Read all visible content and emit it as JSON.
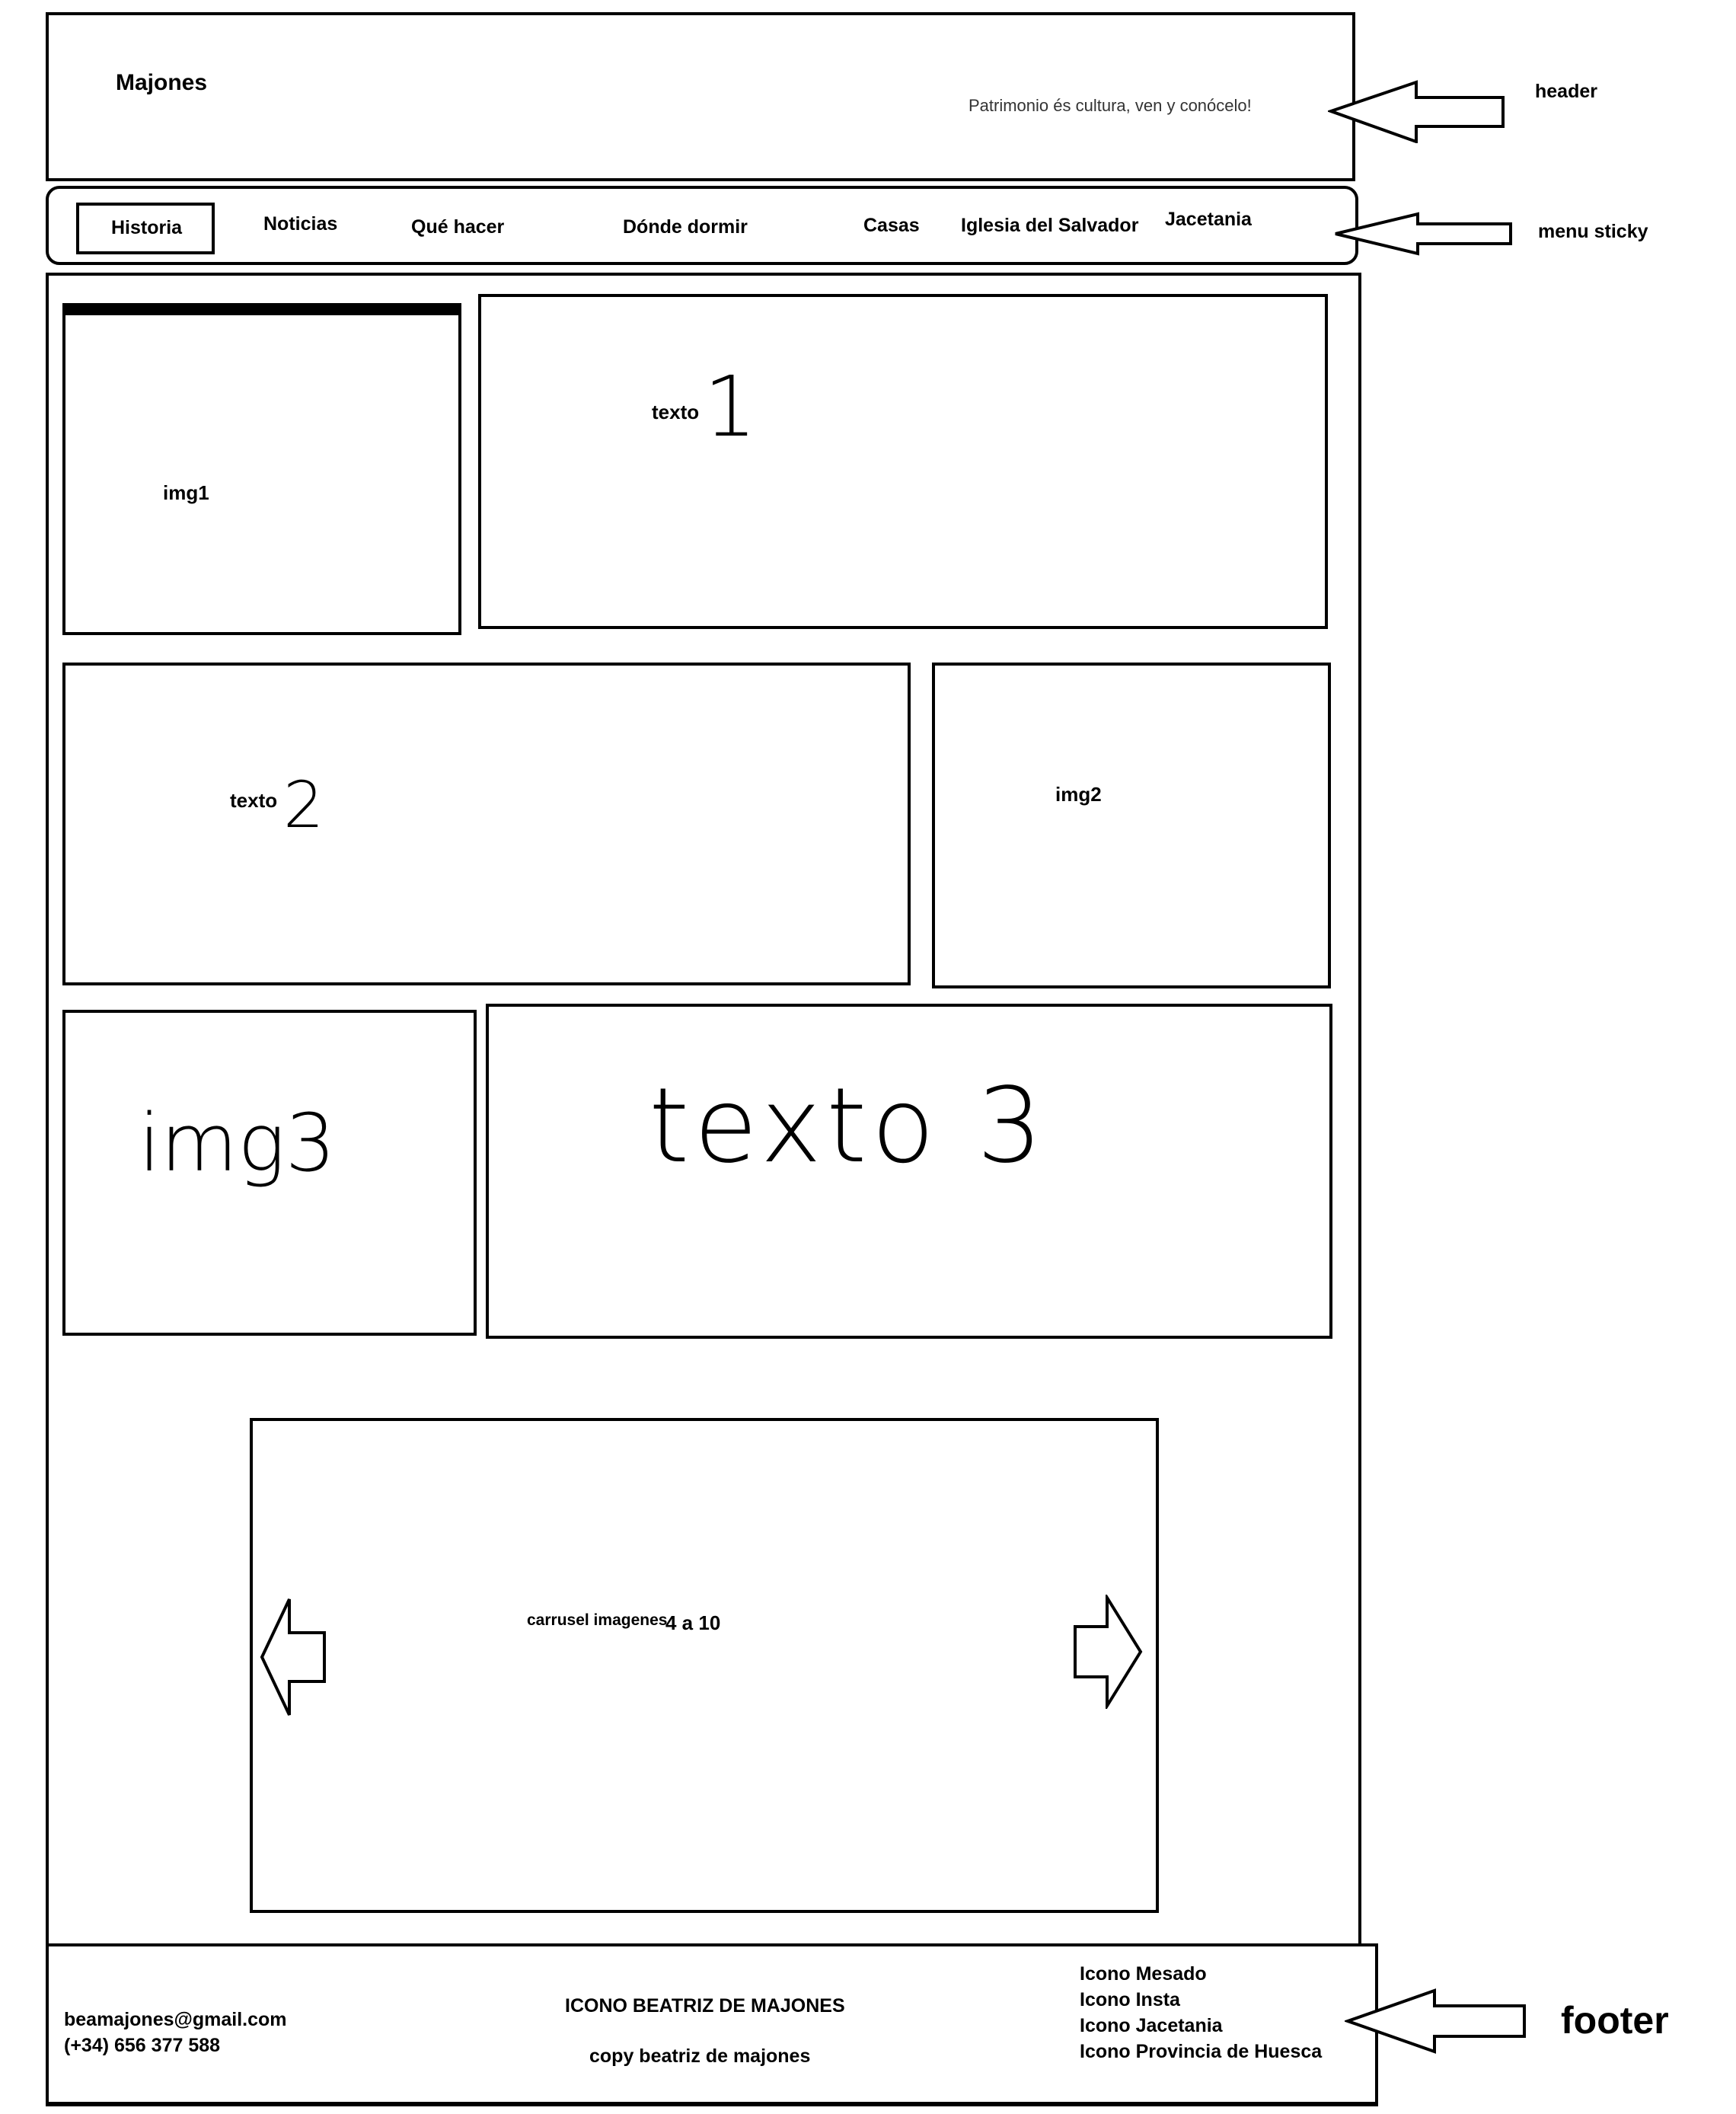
{
  "header": {
    "title": "Majones",
    "tagline": "Patrimonio és cultura, ven y conócelo!"
  },
  "nav": {
    "items": [
      "Historia",
      "Noticias",
      "Qué hacer",
      "Dónde dormir",
      "Casas",
      "Iglesia del Salvador",
      "Jacetania"
    ],
    "active": "Historia"
  },
  "content": {
    "img1": "img1",
    "texto1_word": "texto",
    "texto1_num": "1",
    "texto2_word": "texto",
    "texto2_num": "2",
    "img2": "img2",
    "img3": "img3",
    "texto3": "texto 3",
    "carousel_label": "carrusel imagenes",
    "carousel_range": "4 a 10"
  },
  "footer": {
    "email": "beamajones@gmail.com",
    "phone": "(+34) 656 377 588",
    "center_icon": "ICONO BEATRIZ DE MAJONES",
    "copy": "copy beatriz de majones",
    "links": [
      "Icono Mesado",
      "Icono Insta",
      "Icono Jacetania",
      "Icono Provincia de Huesca"
    ]
  },
  "annotations": {
    "header": "header",
    "menu": "menu sticky",
    "footer": "footer"
  }
}
